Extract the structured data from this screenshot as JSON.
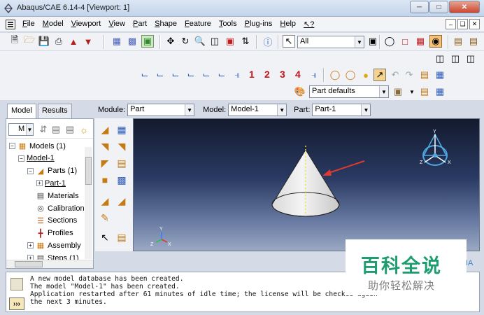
{
  "window": {
    "title": "Abaqus/CAE 6.14-4 [Viewport: 1]"
  },
  "menubar": {
    "items": [
      "File",
      "Model",
      "Viewport",
      "View",
      "Part",
      "Shape",
      "Feature",
      "Tools",
      "Plug-ins",
      "Help",
      "↖?"
    ]
  },
  "toolbar": {
    "selection_filter": "All",
    "datum_csys_numbers": [
      "1",
      "2",
      "3",
      "4"
    ],
    "render_style": "Part defaults"
  },
  "tabs": [
    {
      "label": "Model",
      "active": true
    },
    {
      "label": "Results",
      "active": false
    }
  ],
  "context": {
    "module_label": "Module:",
    "module_value": "Part",
    "model_label": "Model:",
    "model_value": "Model-1",
    "part_label": "Part:",
    "part_value": "Part-1"
  },
  "tree_toolbar": {
    "combo_value": "M"
  },
  "tree": [
    {
      "label": "Models (1)",
      "level": 0,
      "expander": "−",
      "icon": "models-icon"
    },
    {
      "label": "Model-1",
      "level": 1,
      "expander": "−",
      "icon": "",
      "underline": true
    },
    {
      "label": "Parts (1)",
      "level": 2,
      "expander": "−",
      "icon": "parts-icon"
    },
    {
      "label": "Part-1",
      "level": 3,
      "expander": "+",
      "icon": "",
      "underline": true
    },
    {
      "label": "Materials",
      "level": 2,
      "expander": "",
      "icon": "materials-icon"
    },
    {
      "label": "Calibrations",
      "level": 2,
      "expander": "",
      "icon": "calibrations-icon"
    },
    {
      "label": "Sections",
      "level": 2,
      "expander": "",
      "icon": "sections-icon"
    },
    {
      "label": "Profiles",
      "level": 2,
      "expander": "",
      "icon": "profiles-icon"
    },
    {
      "label": "Assembly",
      "level": 2,
      "expander": "+",
      "icon": "assembly-icon"
    },
    {
      "label": "Steps (1)",
      "level": 2,
      "expander": "+",
      "icon": "steps-icon"
    }
  ],
  "viewport": {
    "triad_labels": {
      "x": "X",
      "y": "Y",
      "z": "Z"
    },
    "compass_labels": {
      "y": "Y",
      "z": "Z",
      "x": "X"
    }
  },
  "messages": [
    "A new model database has been created.",
    "The model \"Model-1\" has been created.",
    "Application restarted after 61 minutes of idle time; the license will be checked again",
    "the next 3 minutes."
  ],
  "command_button": "›››",
  "watermark": {
    "title": "百科全说",
    "subtitle": "助你轻松解决",
    "side_text": "IA"
  },
  "colors": {
    "accent_red": "#c4141a",
    "arrow_red": "#e03a2f",
    "watermark_green": "#1e9e70"
  }
}
